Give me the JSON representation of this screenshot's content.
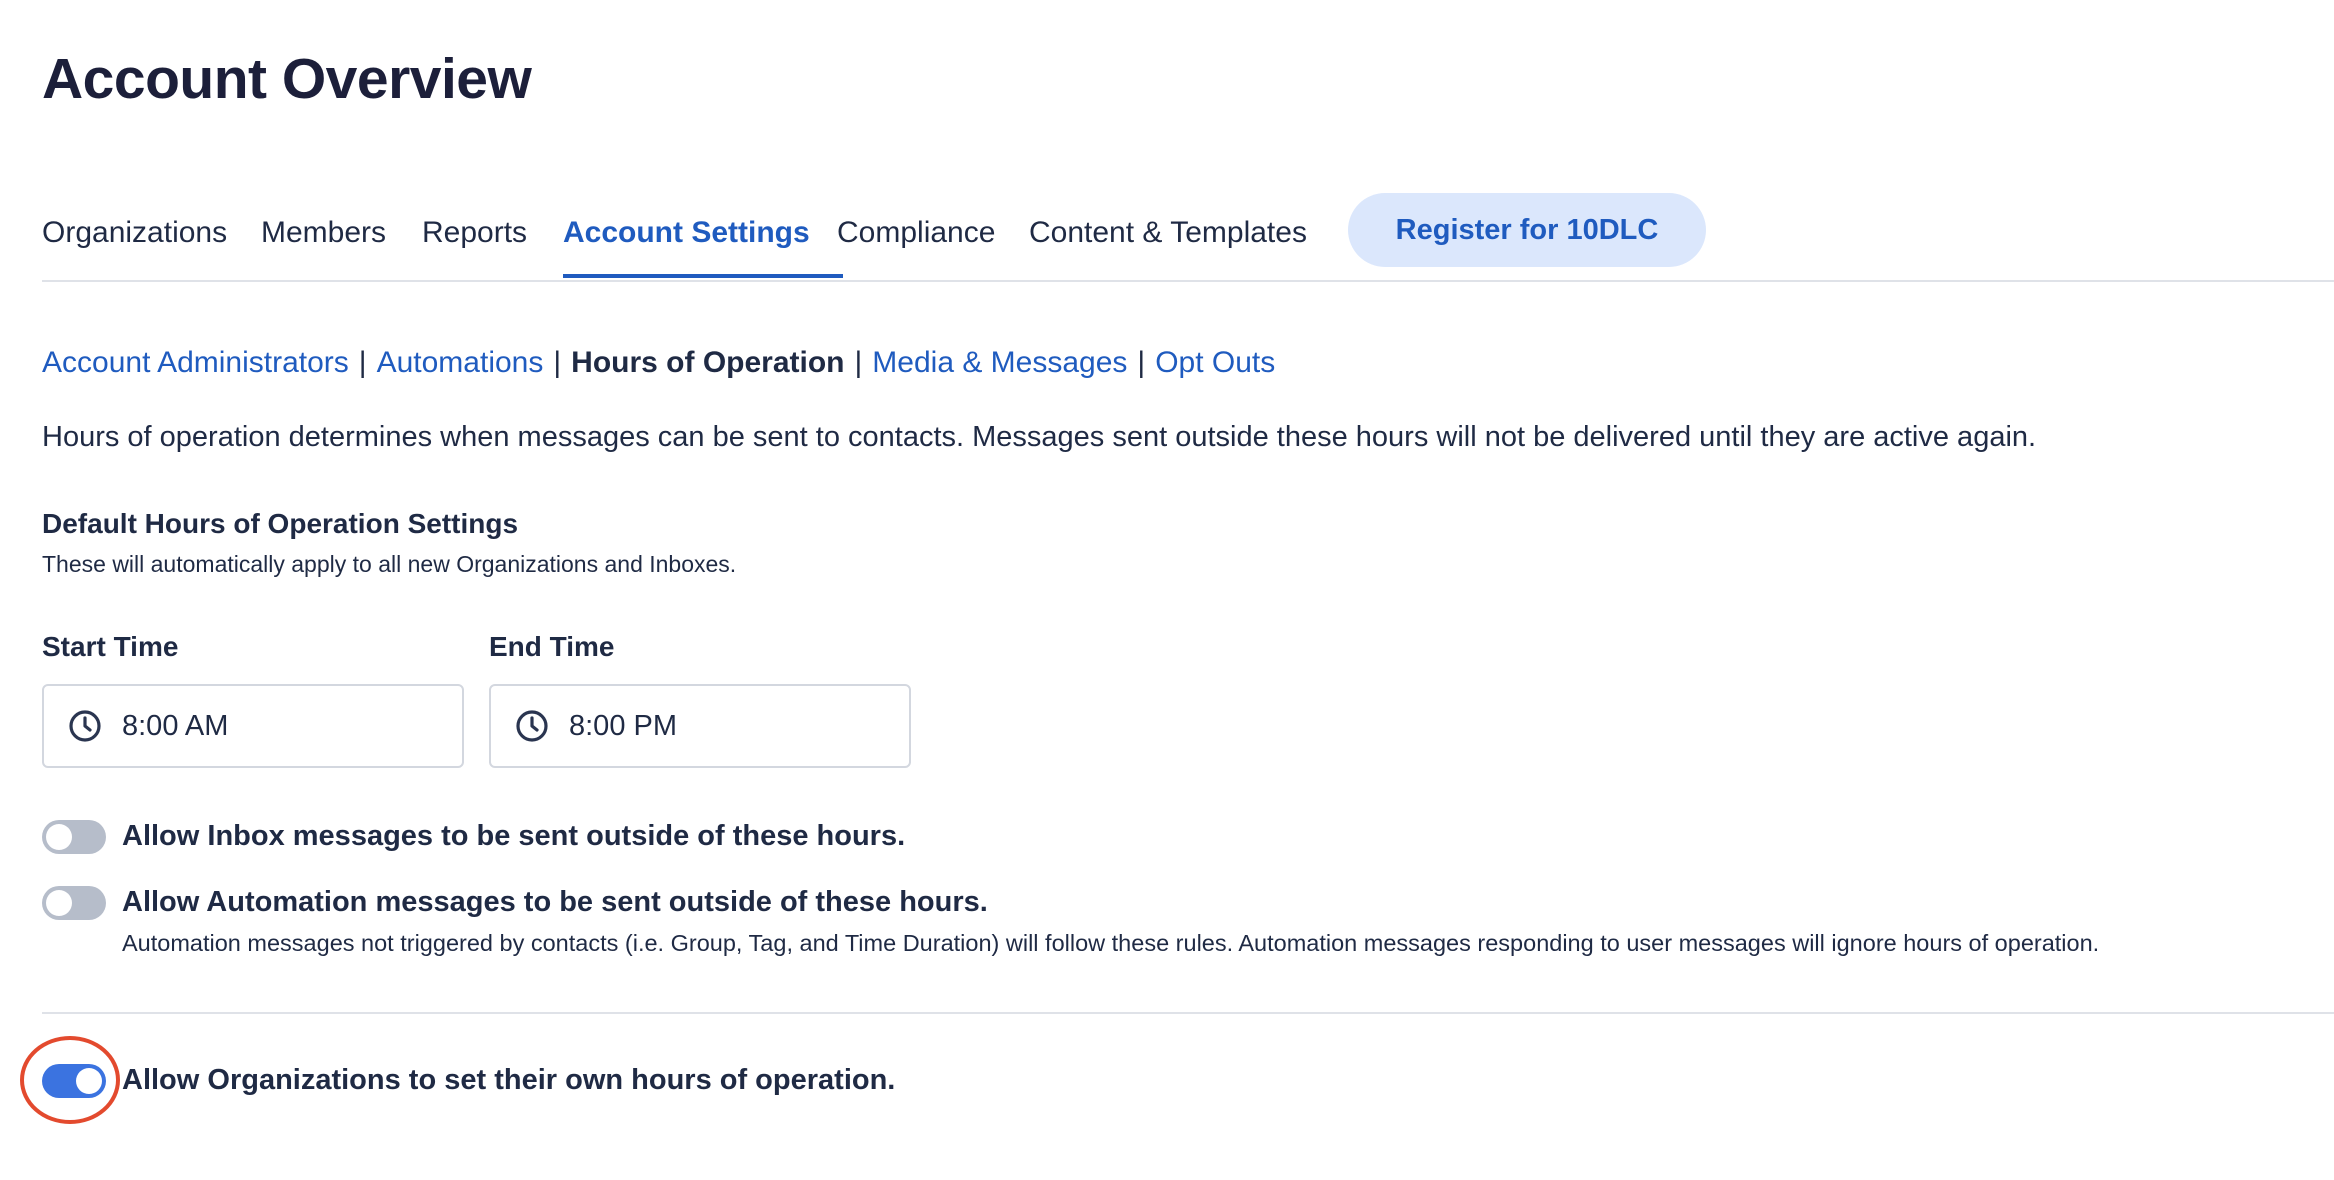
{
  "page": {
    "title": "Account Overview"
  },
  "tabs": [
    {
      "label": "Organizations",
      "active": false
    },
    {
      "label": "Members",
      "active": false
    },
    {
      "label": "Reports",
      "active": false
    },
    {
      "label": "Account Settings",
      "active": true
    },
    {
      "label": "Compliance",
      "active": false
    },
    {
      "label": "Content & Templates",
      "active": false
    }
  ],
  "register_button": {
    "label": "Register for 10DLC"
  },
  "subnav": {
    "items": [
      {
        "label": "Account Administrators",
        "current": false
      },
      {
        "label": "Automations",
        "current": false
      },
      {
        "label": "Hours of Operation",
        "current": true
      },
      {
        "label": "Media & Messages",
        "current": false
      },
      {
        "label": "Opt Outs",
        "current": false
      }
    ],
    "separator": "|"
  },
  "description": "Hours of operation determines when messages can be sent to contacts. Messages sent outside these hours will not be delivered until they are active again.",
  "defaults": {
    "title": "Default Hours of Operation Settings",
    "subtitle": "These will automatically apply to all new Organizations and Inboxes.",
    "start_time": {
      "label": "Start Time",
      "value": "8:00 AM",
      "icon": "clock-icon"
    },
    "end_time": {
      "label": "End Time",
      "value": "8:00 PM",
      "icon": "clock-icon"
    }
  },
  "toggles": {
    "inbox": {
      "label": "Allow Inbox messages to be sent outside of these hours.",
      "on": false
    },
    "automation": {
      "label": "Allow Automation messages to be sent outside of these hours.",
      "help": "Automation messages not triggered by contacts (i.e. Group, Tag, and Time Duration) will follow these rules. Automation messages responding to user messages will ignore hours of operation.",
      "on": false
    },
    "organizations": {
      "label": "Allow Organizations to set their own hours of operation.",
      "on": true
    }
  },
  "colors": {
    "accent": "#1f5bbf",
    "toggle_on": "#3b73e0",
    "toggle_off": "#b6bdca",
    "highlight": "#e34a2e",
    "text": "#1f2a44"
  }
}
